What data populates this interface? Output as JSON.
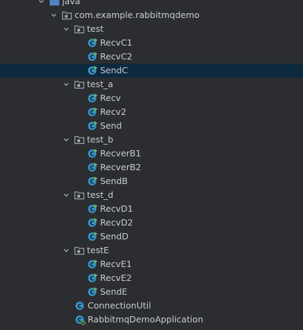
{
  "tree": {
    "rows": [
      {
        "label": "java",
        "kind": "source-folder",
        "depth": 0,
        "expanded": true
      },
      {
        "label": "com.example.rabbitmqdemo",
        "kind": "package",
        "depth": 1,
        "expanded": true
      },
      {
        "label": "test",
        "kind": "package",
        "depth": 2,
        "expanded": true
      },
      {
        "label": "RecvC1",
        "kind": "runnable-class",
        "depth": 3
      },
      {
        "label": "RecvC2",
        "kind": "runnable-class",
        "depth": 3
      },
      {
        "label": "SendC",
        "kind": "runnable-class",
        "depth": 3,
        "selected": true
      },
      {
        "label": "test_a",
        "kind": "package",
        "depth": 2,
        "expanded": true
      },
      {
        "label": "Recv",
        "kind": "runnable-class",
        "depth": 3
      },
      {
        "label": "Recv2",
        "kind": "runnable-class",
        "depth": 3
      },
      {
        "label": "Send",
        "kind": "runnable-class",
        "depth": 3
      },
      {
        "label": "test_b",
        "kind": "package",
        "depth": 2,
        "expanded": true
      },
      {
        "label": "RecverB1",
        "kind": "runnable-class",
        "depth": 3
      },
      {
        "label": "RecverB2",
        "kind": "runnable-class",
        "depth": 3
      },
      {
        "label": "SendB",
        "kind": "runnable-class",
        "depth": 3
      },
      {
        "label": "test_d",
        "kind": "package",
        "depth": 2,
        "expanded": true
      },
      {
        "label": "RecvD1",
        "kind": "runnable-class",
        "depth": 3
      },
      {
        "label": "RecvD2",
        "kind": "runnable-class",
        "depth": 3
      },
      {
        "label": "SendD",
        "kind": "runnable-class",
        "depth": 3
      },
      {
        "label": "testE",
        "kind": "package",
        "depth": 2,
        "expanded": true
      },
      {
        "label": "RecvE1",
        "kind": "runnable-class",
        "depth": 3
      },
      {
        "label": "RecvE2",
        "kind": "runnable-class",
        "depth": 3
      },
      {
        "label": "SendE",
        "kind": "runnable-class",
        "depth": 3
      },
      {
        "label": "ConnectionUtil",
        "kind": "class",
        "depth": 2
      },
      {
        "label": "RabbitmqDemoApplication",
        "kind": "spring-boot-class",
        "depth": 2
      },
      {
        "label": "",
        "kind": "collapsed-folder",
        "depth": 0,
        "expanded": false
      }
    ]
  },
  "colors": {
    "background": "#2b2d30",
    "selection": "#0d293e",
    "text": "#c9ccd1",
    "class_icon": "#3592c4",
    "run_badge": "#5fb865",
    "folder": "#9aa7b0",
    "source_folder": "#4f84c3"
  }
}
